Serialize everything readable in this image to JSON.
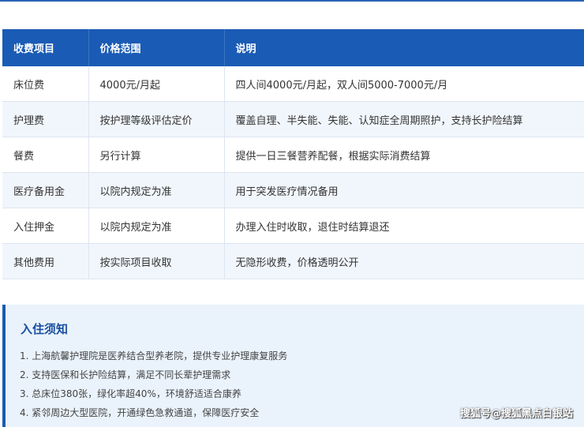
{
  "fee_table": {
    "headers": [
      "收费项目",
      "价格范围",
      "说明"
    ],
    "rows": [
      {
        "item": "床位费",
        "price": "4000元/月起",
        "note": "四人间4000元/月起，双人间5000-7000元/月"
      },
      {
        "item": "护理费",
        "price": "按护理等级评估定价",
        "note": "覆盖自理、半失能、失能、认知症全周期照护，支持长护险结算"
      },
      {
        "item": "餐费",
        "price": "另行计算",
        "note": "提供一日三餐营养配餐，根据实际消费结算"
      },
      {
        "item": "医疗备用金",
        "price": "以院内规定为准",
        "note": "用于突发医疗情况备用"
      },
      {
        "item": "入住押金",
        "price": "以院内规定为准",
        "note": "办理入住时收取，退住时结算退还"
      },
      {
        "item": "其他费用",
        "price": "按实际项目收取",
        "note": "无隐形收费，价格透明公开"
      }
    ]
  },
  "notice": {
    "title": "入住须知",
    "items": [
      "1. 上海航馨护理院是医养结合型养老院，提供专业护理康复服务",
      "2. 支持医保和长护险结算，满足不同长辈护理需求",
      "3. 总床位380张，绿化率超40%，环境舒适适合康养",
      "4. 紧邻周边大型医院，开通绿色急救通道，保障医疗安全"
    ]
  },
  "watermark": "搜狐号@搜狐黑点白银站",
  "colors": {
    "header_bg": "#1a5bb5",
    "row_alt_bg": "#f1f6fc",
    "notice_bg": "#eaf3fc",
    "notice_title": "#1a4fa0"
  }
}
